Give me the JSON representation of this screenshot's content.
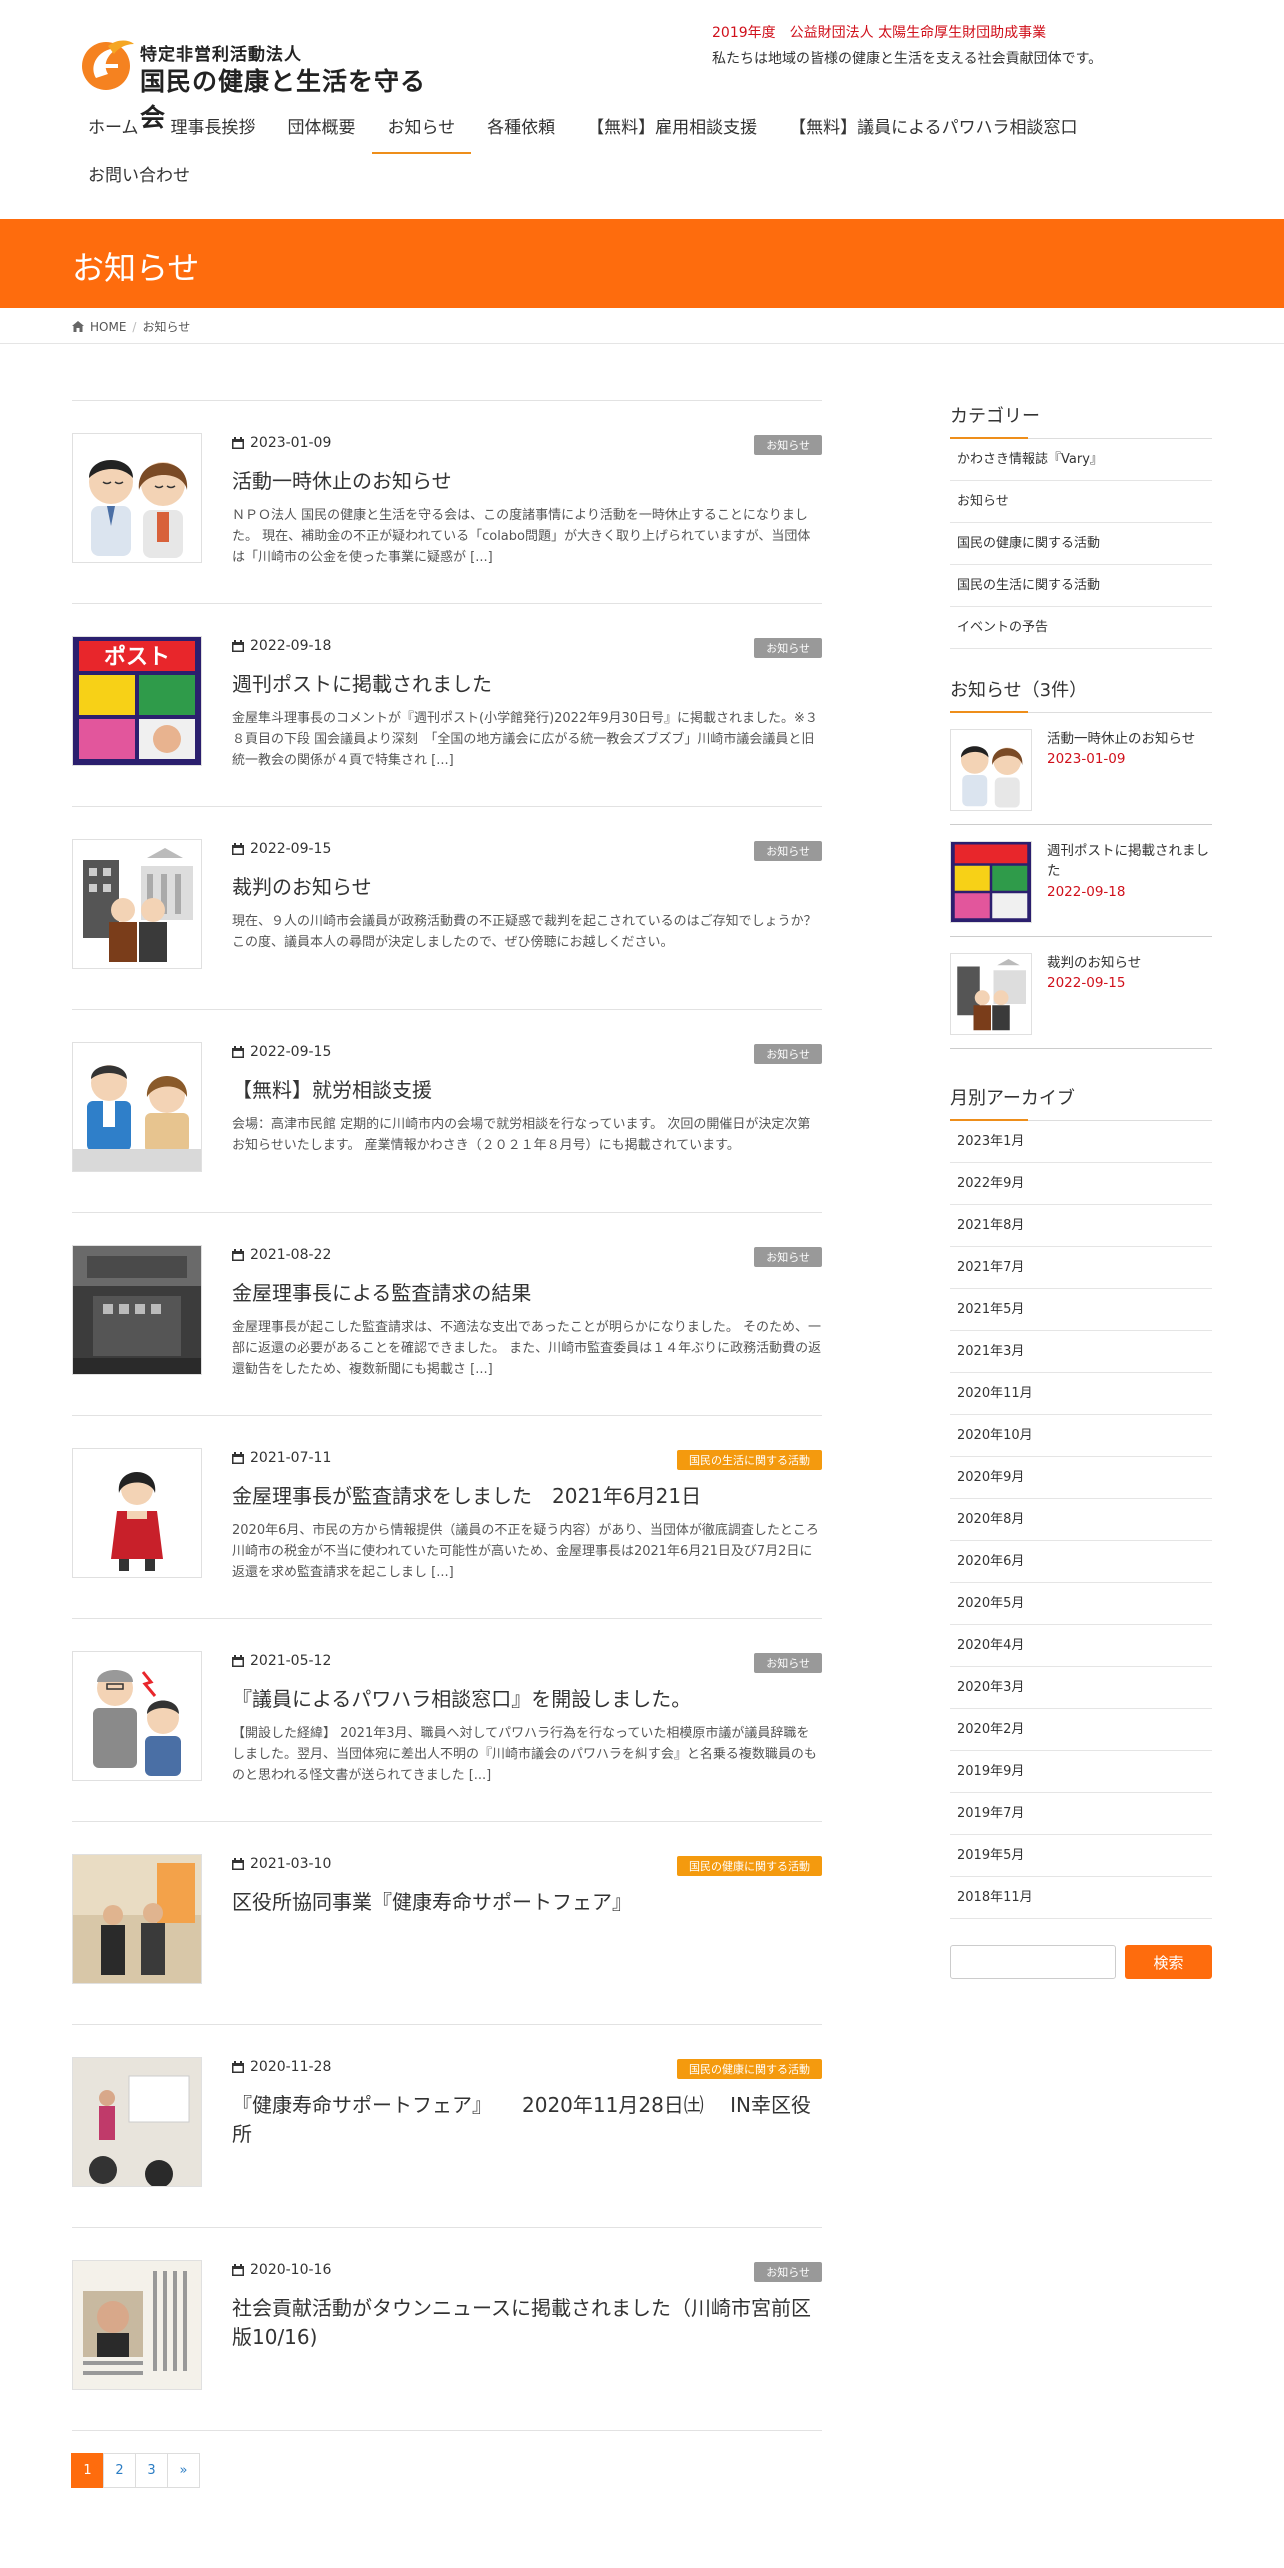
{
  "site": {
    "logo_sub": "特定非営利活動法人",
    "logo_main": "国民の健康と生活を守る会",
    "tagline_1": "2019年度　公益財団法人 太陽生命厚生財団助成事業",
    "tagline_2": "私たちは地域の皆様の健康と生活を支える社会貢献団体です。"
  },
  "nav": {
    "items": [
      "ホーム",
      "理事長挨拶",
      "団体概要",
      "お知らせ",
      "各種依頼",
      "【無料】雇用相談支援",
      "【無料】議員によるパワハラ相談窓口",
      "お問い合わせ"
    ]
  },
  "page": {
    "title": "お知らせ",
    "breadcrumb_home": "HOME",
    "breadcrumb_current": "お知らせ"
  },
  "posts": [
    {
      "date": "2023-01-09",
      "category": "お知らせ",
      "title": "活動一時休止のお知らせ",
      "excerpt": "ＮＰＯ法人 国民の健康と生活を守る会は、この度諸事情により活動を一時休止することになりました。 現在、補助金の不正が疑われている「colabo問題」が大きく取り上げられていますが、当団体は「川崎市の公金を使った事業に疑惑が [...]"
    },
    {
      "date": "2022-09-18",
      "category": "お知らせ",
      "title": "週刊ポストに掲載されました",
      "excerpt": "金屋隼斗理事長のコメントが『週刊ポスト(小学館発行)2022年9月30日号』に掲載されました。※３８頁目の下段 国会議員より深刻　「全国の地方議会に広がる統一教会ズブズブ」川崎市議会議員と旧統一教会の関係が４頁で特集され [...]"
    },
    {
      "date": "2022-09-15",
      "category": "お知らせ",
      "title": "裁判のお知らせ",
      "excerpt": "現在、９人の川崎市会議員が政務活動費の不正疑惑で裁判を起こされているのはご存知でしょうか？ この度、議員本人の尋問が決定しましたので、ぜひ傍聴にお越しください。"
    },
    {
      "date": "2022-09-15",
      "category": "お知らせ",
      "title": "【無料】就労相談支援",
      "excerpt": "会場：高津市民館 定期的に川崎市内の会場で就労相談を行なっています。 次回の開催日が決定次第お知らせいたします。 産業情報かわさき（２０２１年８月号）にも掲載されています。"
    },
    {
      "date": "2021-08-22",
      "category": "お知らせ",
      "title": "金屋理事長による監査請求の結果",
      "excerpt": "金屋理事長が起こした監査請求は、不適法な支出であったことが明らかになりました。 そのため、一部に返還の必要があることを確認できました。 また、川崎市監査委員は１４年ぶりに政務活動費の返還勧告をしたため、複数新聞にも掲載さ [...]"
    },
    {
      "date": "2021-07-11",
      "category": "国民の生活に関する活動",
      "title": "金屋理事長が監査請求をしました　2021年6月21日",
      "excerpt": "2020年6月、市民の方から情報提供（議員の不正を疑う内容）があり、当団体が徹底調査したところ川崎市の税金が不当に使われていた可能性が高いため、金屋理事長は2021年6月21日及び7月2日に返還を求め監査請求を起こしまし [...]"
    },
    {
      "date": "2021-05-12",
      "category": "お知らせ",
      "title": "『議員によるパワハラ相談窓口』を開設しました。",
      "excerpt": "【開設した経緯】 2021年3月、職員へ対してパワハラ行為を行なっていた相模原市議が議員辞職をしました。翌月、当団体宛に差出人不明の『川崎市議会のパワハラを糾す会』と名乗る複数職員のものと思われる怪文書が送られてきました [...]"
    },
    {
      "date": "2021-03-10",
      "category": "国民の健康に関する活動",
      "title": "区役所協同事業『健康寿命サポートフェア』",
      "excerpt": ""
    },
    {
      "date": "2020-11-28",
      "category": "国民の健康に関する活動",
      "title": "『健康寿命サポートフェア』　　2020年11月28日㈯　 IN幸区役所",
      "excerpt": ""
    },
    {
      "date": "2020-10-16",
      "category": "お知らせ",
      "title": "社会貢献活動がタウンニュースに掲載されました（川崎市宮前区版10/16)",
      "excerpt": ""
    }
  ],
  "sidebar": {
    "category_heading": "カテゴリー",
    "categories": [
      "かわさき情報誌『Vary』",
      "お知らせ",
      "国民の健康に関する活動",
      "国民の生活に関する活動",
      "イベントの予告"
    ],
    "news_heading": "お知らせ（3件）",
    "news": [
      {
        "title": "活動一時休止のお知らせ",
        "date": "2023-01-09"
      },
      {
        "title": "週刊ポストに掲載されました",
        "date": "2022-09-18"
      },
      {
        "title": "裁判のお知らせ",
        "date": "2022-09-15"
      }
    ],
    "archive_heading": "月別アーカイブ",
    "archives": [
      "2023年1月",
      "2022年9月",
      "2021年8月",
      "2021年7月",
      "2021年5月",
      "2021年3月",
      "2020年11月",
      "2020年10月",
      "2020年9月",
      "2020年8月",
      "2020年6月",
      "2020年5月",
      "2020年4月",
      "2020年3月",
      "2020年2月",
      "2019年9月",
      "2019年7月",
      "2019年5月",
      "2018年11月"
    ],
    "search_button": "検索"
  },
  "pagination": [
    "1",
    "2",
    "3",
    "»"
  ],
  "colors": {
    "accent": "#fe6c0d",
    "badge_gray": "#999999",
    "badge_orange": "#f49a0e",
    "date_red": "#d0101b"
  }
}
